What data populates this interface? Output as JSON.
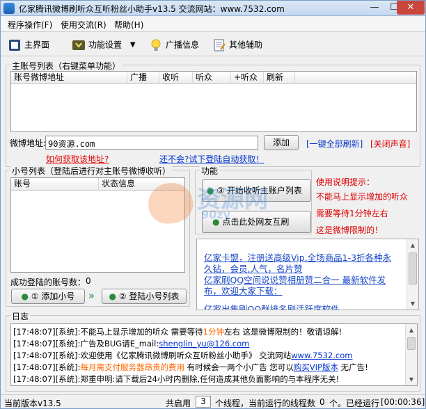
{
  "window": {
    "title": "亿家腾讯微博刷听众互听粉丝小助手v13.5    交流网站：www.7532.com",
    "minimize": "—",
    "maximize": "☐",
    "close": "✕"
  },
  "menu": [
    "程序操作(F)",
    "使用交流(R)",
    "帮助(H)"
  ],
  "toolbar": {
    "main": "主界面",
    "settings": "功能设置",
    "broadcast": "广播信息",
    "other": "其他辅助"
  },
  "main_accounts": {
    "legend": "主账号列表（右键菜单功能）",
    "columns": [
      "账号微博地址",
      "广播",
      "收听",
      "听众",
      "+听众",
      "刷新"
    ],
    "weibo_label": "微博地址:",
    "weibo_value": "90资源.com",
    "add_button": "添加",
    "refresh_all": "[一键全部刷新]",
    "mute": "[关闭声音]",
    "how_get": "如何获取该地址?",
    "auto_get": "还不会?试下登陆自动获取！"
  },
  "sub_accounts": {
    "legend": "小号列表（登陆后进行对主账号微博收听）",
    "columns": [
      "账号",
      "状态信息"
    ],
    "success_label": "成功登陆的账号数：",
    "success_count": "0",
    "add_button": "① 添加小号",
    "arrow": "»",
    "login_button": "② 登陆小号列表"
  },
  "function": {
    "legend": "功能",
    "start_button": "③ 开始收听主账户列表",
    "mutual_button": "点击此处网友互刷"
  },
  "tips": {
    "title": "使用说明提示：",
    "line1": "不能马上显示增加的听众",
    "line2": "需要等待1分钟左右",
    "line3": "这是微博限制的！"
  },
  "watermark": {
    "text": "资源网",
    "sub": "90zy"
  },
  "ads": [
    "亿家卡盟，注册送高级Vip,全场商品1-3折各种永",
    "久钻，会员,人气，名片赞",
    "亿家刷QQ空间说说赞相册赞二合一  最新软件发",
    "布，欢迎大家下载：",
    "亿家出售刷QQ群排名刷活跃度软件"
  ],
  "log": {
    "legend": "日志",
    "lines": [
      {
        "t": "[17:48:07]",
        "s": "[系统]:",
        "a": "不能马上显示增加的听众 需要等待",
        "b": "1分钟",
        "c": "左右 这是微博限制的！敬请谅解!",
        "d": "",
        "e": ""
      },
      {
        "t": "[17:48:07]",
        "s": "[系统]:",
        "a": "广告及BUG请E_mail:",
        "b": "",
        "c": "",
        "d": "shenglin_yu@126.com",
        "e": ""
      },
      {
        "t": "[17:48:07]",
        "s": "[系统]:",
        "a": "欢迎使用《亿家腾讯微博刷听众互听粉丝小助手》 交流网站",
        "b": "",
        "c": "",
        "d": "www.7532.com",
        "e": ""
      },
      {
        "t": "[17:48:07]",
        "s": "[系统]:",
        "a": "",
        "b": "每月需支付服务器昂贵的费用",
        "c": " 有时候会一两个小广告 您可以",
        "d": "购买VIP版本",
        "e": " 无广告!"
      },
      {
        "t": "[17:48:07]",
        "s": "[系统]:",
        "a": "郑重申明:请下载后24小时内删除,任何造成其他负面影响的与本程序无关!",
        "b": "",
        "c": "",
        "d": "",
        "e": ""
      }
    ]
  },
  "status": {
    "version": "当前版本v13.5",
    "threads_label": "共启用",
    "threads_value": "3",
    "threads_suffix": "个线程，当前运行的线程数",
    "running": "0",
    "running_suffix": "个。已经运行",
    "elapsed": "[00:00:36]"
  },
  "colors": {
    "link_blue": "#0033cc",
    "warn_red": "#e00000",
    "highlight_orange": "#ff6600",
    "title_gradient": "#c5d8ef"
  }
}
